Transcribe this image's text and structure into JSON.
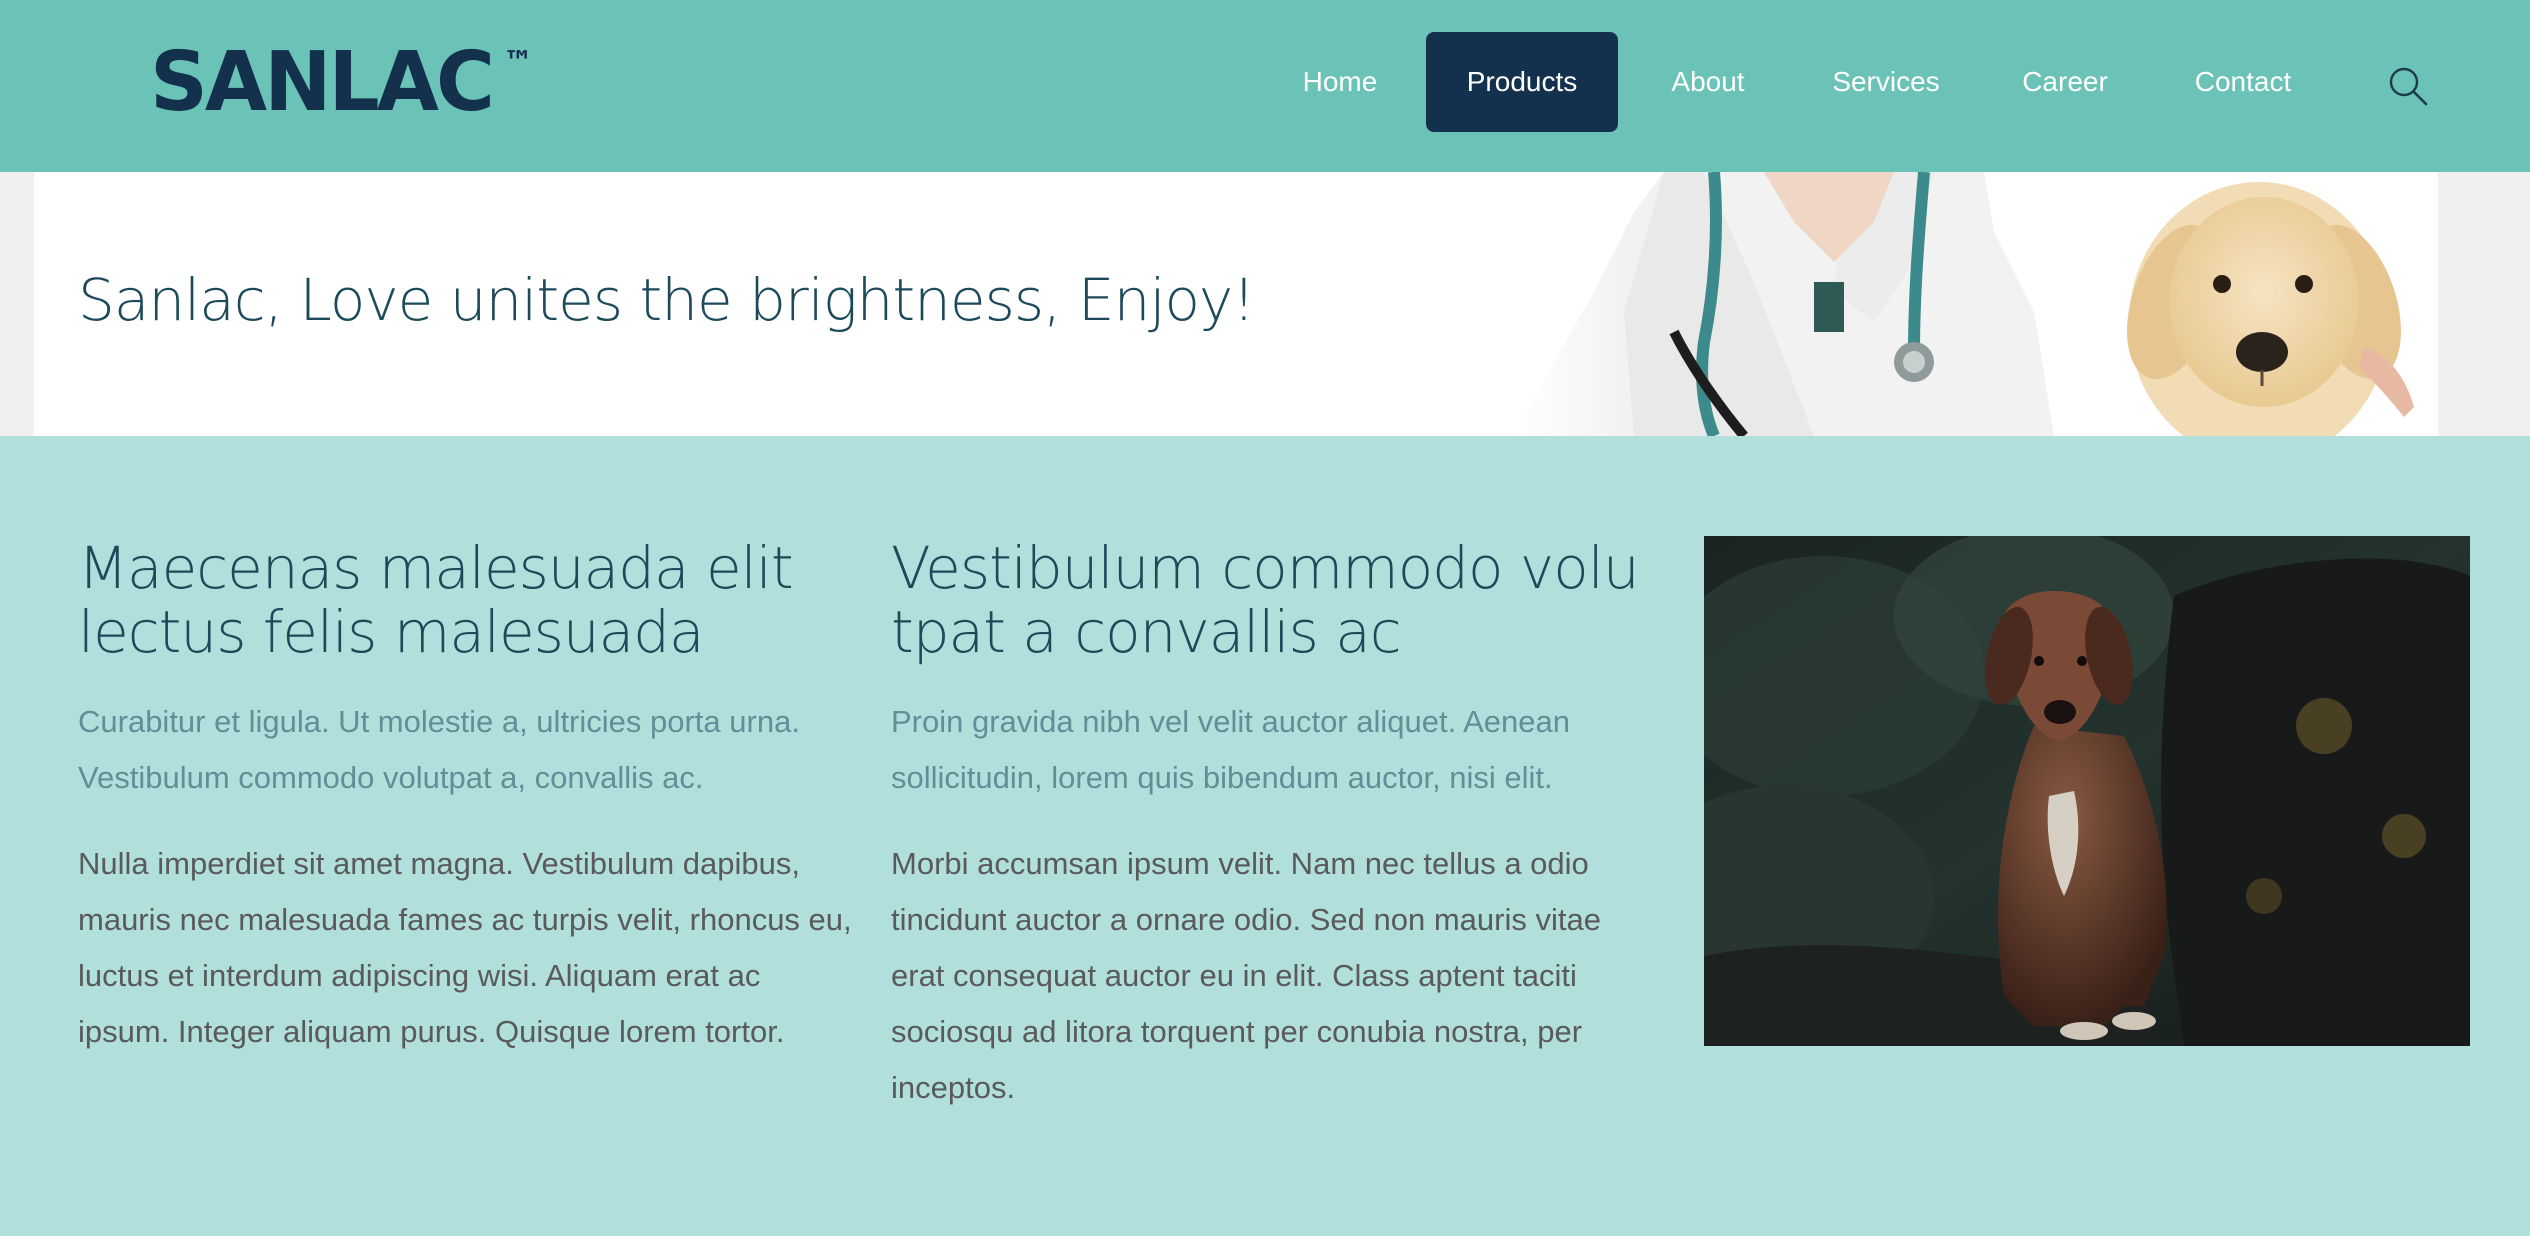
{
  "header": {
    "logo": {
      "text": "SANLAC",
      "tm": "™"
    },
    "nav": [
      "Home",
      "Products",
      "About",
      "Services",
      "Career",
      "Contact"
    ],
    "active_nav": "Products",
    "search_icon": "search-icon"
  },
  "banner": {
    "title": "Sanlac, Love unites the brightness, Enjoy!"
  },
  "columns": [
    {
      "title_line1": "Maecenas malesuada elit",
      "title_line2": "lectus felis malesuada",
      "lead": "Curabitur et ligula. Ut molestie a, ultricies porta urna. Vestibulum commodo volutpat a, convallis ac.",
      "body": "Nulla imperdiet sit amet magna. Vestibulum dapibus, mauris nec malesuada fames ac turpis velit, rhoncus eu, luctus et interdum adipiscing wisi. Aliquam erat ac ipsum. Integer aliquam purus. Quisque lorem tortor."
    },
    {
      "title_line1": "Vestibulum commodo volu",
      "title_line2": "tpat a convallis ac",
      "lead": "Proin gravida nibh vel velit auctor aliquet. Aenean sollicitudin, lorem quis bibendum auctor, nisi elit.",
      "body": "Morbi accumsan ipsum velit. Nam nec tellus a odio tincidunt auctor a ornare odio. Sed non mauris vitae erat consequat auctor eu in elit. Class aptent taciti sociosqu ad litora torquent per conubia nostra, per inceptos."
    }
  ],
  "colors": {
    "header_bg": "#6bc3b8",
    "page_bg": "#b1e0dc",
    "accent_dark": "#13314d",
    "heading": "#1c4a5a",
    "lead_text": "#5f8f97",
    "body_text": "#5a5a5a"
  }
}
